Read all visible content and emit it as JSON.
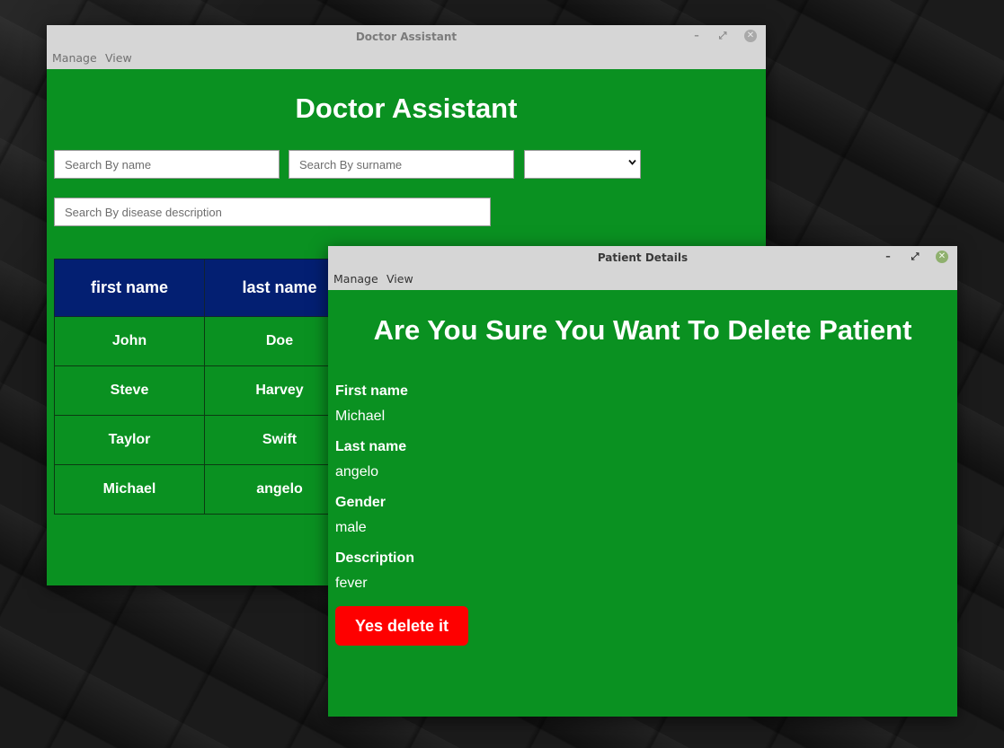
{
  "main_window": {
    "title": "Doctor Assistant",
    "menu": [
      "Manage",
      "View"
    ],
    "controls": {
      "minimize": "–",
      "maximize": "⤢",
      "close": "✕"
    },
    "heading": "Doctor Assistant",
    "search": {
      "name_placeholder": "Search By name",
      "surname_placeholder": "Search By surname",
      "gender_selected": "",
      "description_placeholder": "Search By disease description"
    },
    "table": {
      "headers": [
        "first name",
        "last name"
      ],
      "rows": [
        [
          "John",
          "Doe"
        ],
        [
          "Steve",
          "Harvey"
        ],
        [
          "Taylor",
          "Swift"
        ],
        [
          "Michael",
          "angelo"
        ]
      ]
    }
  },
  "dialog_window": {
    "title": "Patient Details",
    "menu": [
      "Manage",
      "View"
    ],
    "controls": {
      "minimize": "–",
      "maximize": "⤢",
      "close": "✕"
    },
    "heading": "Are You Sure You Want To Delete Patient",
    "fields": [
      {
        "label": "First name",
        "value": "Michael"
      },
      {
        "label": "Last name",
        "value": "angelo"
      },
      {
        "label": "Gender",
        "value": "male"
      },
      {
        "label": "Description",
        "value": "fever"
      }
    ],
    "delete_button": "Yes delete it"
  },
  "colors": {
    "window_bg": "#0a9121",
    "table_header_bg": "#031f72",
    "delete_button_bg": "#fe0000",
    "titlebar_bg": "#d6d6d6"
  },
  "icons": {
    "select_chevron": "chevron-down-icon"
  }
}
